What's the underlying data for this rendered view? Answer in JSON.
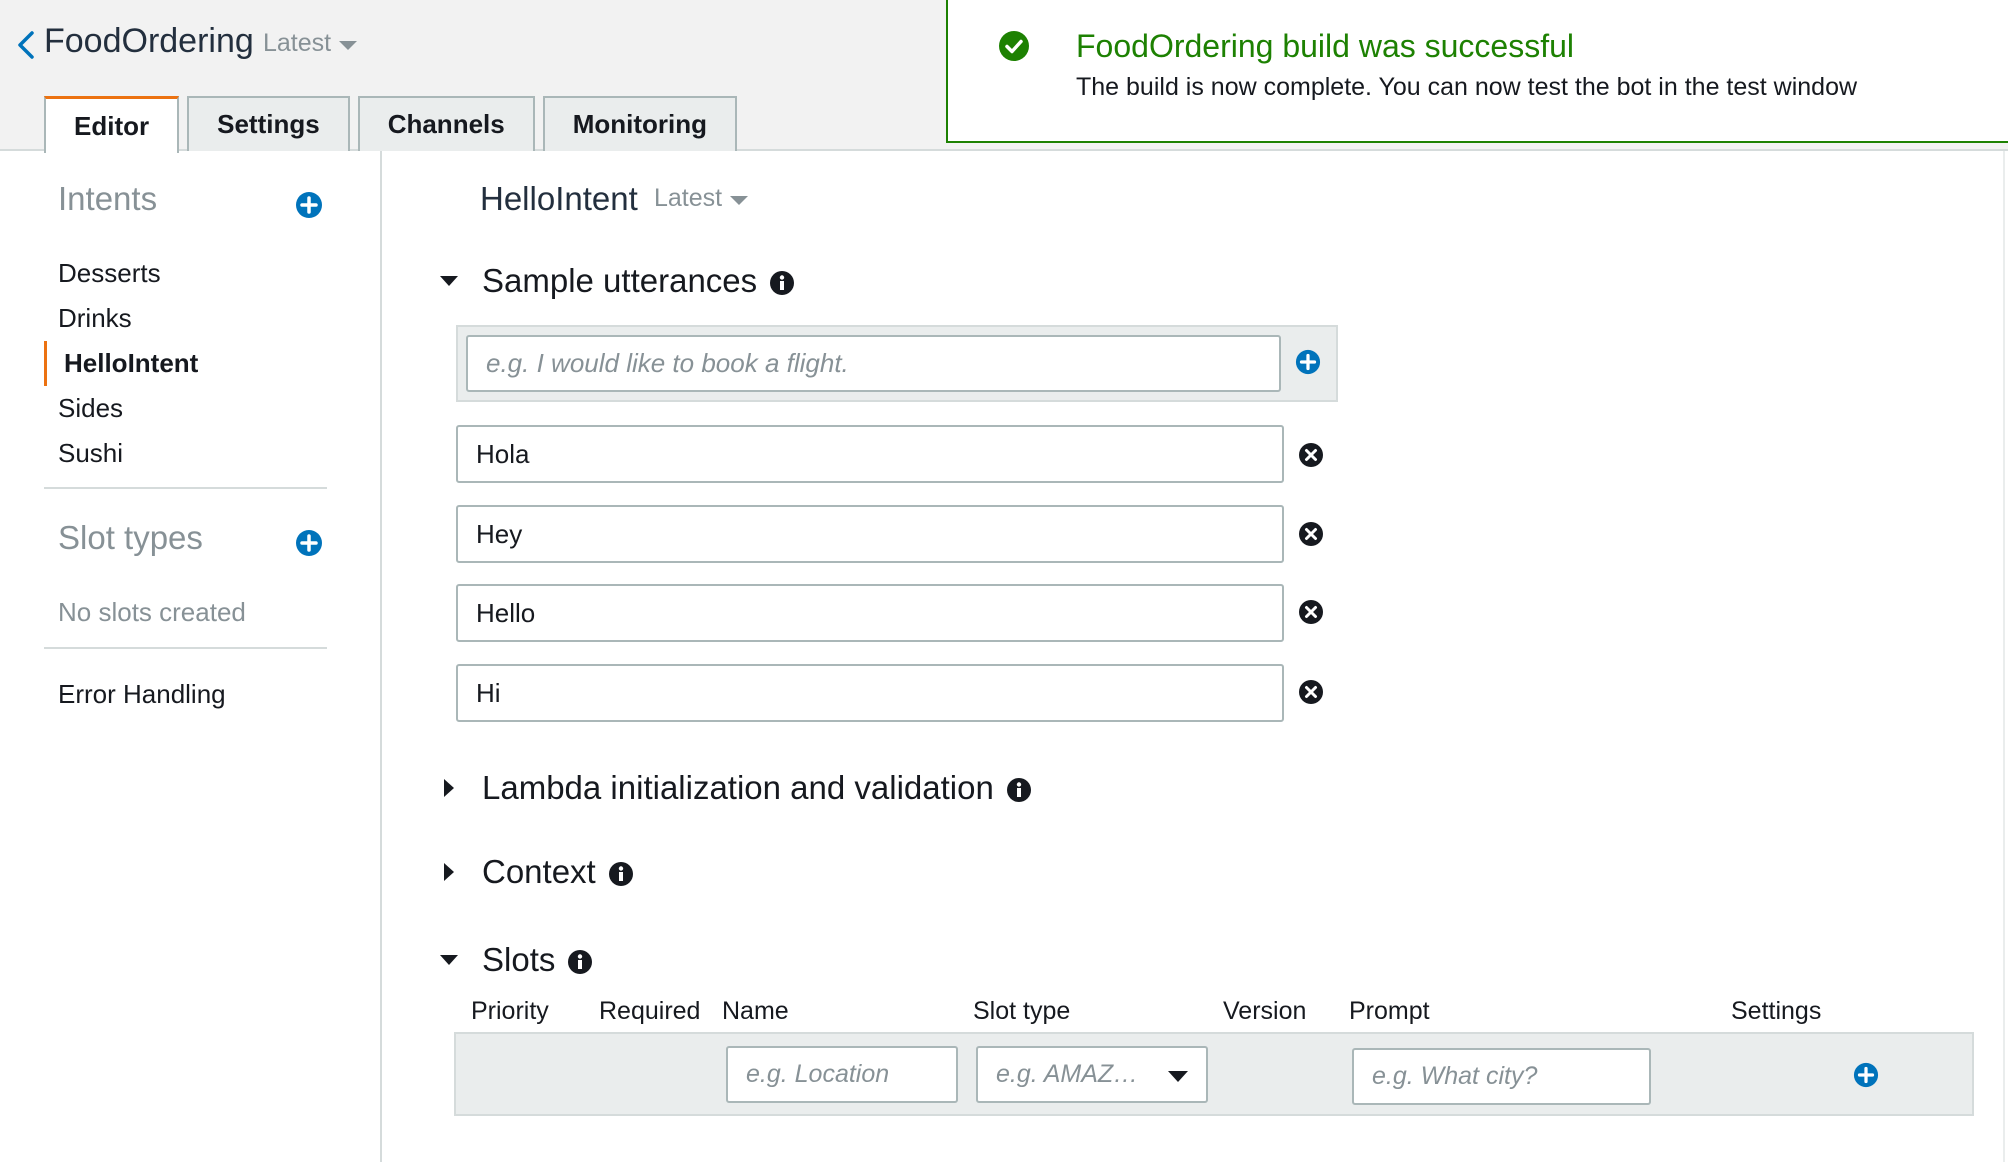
{
  "header": {
    "app_title": "FoodOrdering",
    "version": "Latest",
    "tabs": [
      {
        "label": "Editor",
        "active": true
      },
      {
        "label": "Settings",
        "active": false
      },
      {
        "label": "Channels",
        "active": false
      },
      {
        "label": "Monitoring",
        "active": false
      }
    ]
  },
  "flash": {
    "status": "success",
    "icon": "check-circle-icon",
    "title": "FoodOrdering build was successful",
    "message": "The build is now complete. You can now test the bot in the test window"
  },
  "sidebar": {
    "intents_heading": "Intents",
    "intents": [
      {
        "label": "Desserts",
        "selected": false
      },
      {
        "label": "Drinks",
        "selected": false
      },
      {
        "label": "HelloIntent",
        "selected": true
      },
      {
        "label": "Sides",
        "selected": false
      },
      {
        "label": "Sushi",
        "selected": false
      }
    ],
    "slot_types_heading": "Slot types",
    "slot_types_empty": "No slots created",
    "error_handling": "Error Handling"
  },
  "main": {
    "intent_name": "HelloIntent",
    "intent_version": "Latest",
    "sample_utterances": {
      "label": "Sample utterances",
      "expanded": true,
      "placeholder": "e.g. I would like to book a flight.",
      "items": [
        "Hola",
        "Hey",
        "Hello",
        "Hi"
      ]
    },
    "lambda_section": {
      "label": "Lambda initialization and validation",
      "expanded": false
    },
    "context_section": {
      "label": "Context",
      "expanded": false
    },
    "slots": {
      "label": "Slots",
      "expanded": true,
      "columns": {
        "priority": "Priority",
        "required": "Required",
        "name": "Name",
        "slot_type": "Slot type",
        "version": "Version",
        "prompt": "Prompt",
        "settings": "Settings"
      },
      "new_row": {
        "name_placeholder": "e.g. Location",
        "slot_type_placeholder": "e.g. AMAZ…",
        "prompt_placeholder": "e.g. What city?"
      }
    }
  },
  "colors": {
    "accent": "#ec7211",
    "success": "#1d8102",
    "link_blue": "#0073bb",
    "muted": "#879196"
  }
}
